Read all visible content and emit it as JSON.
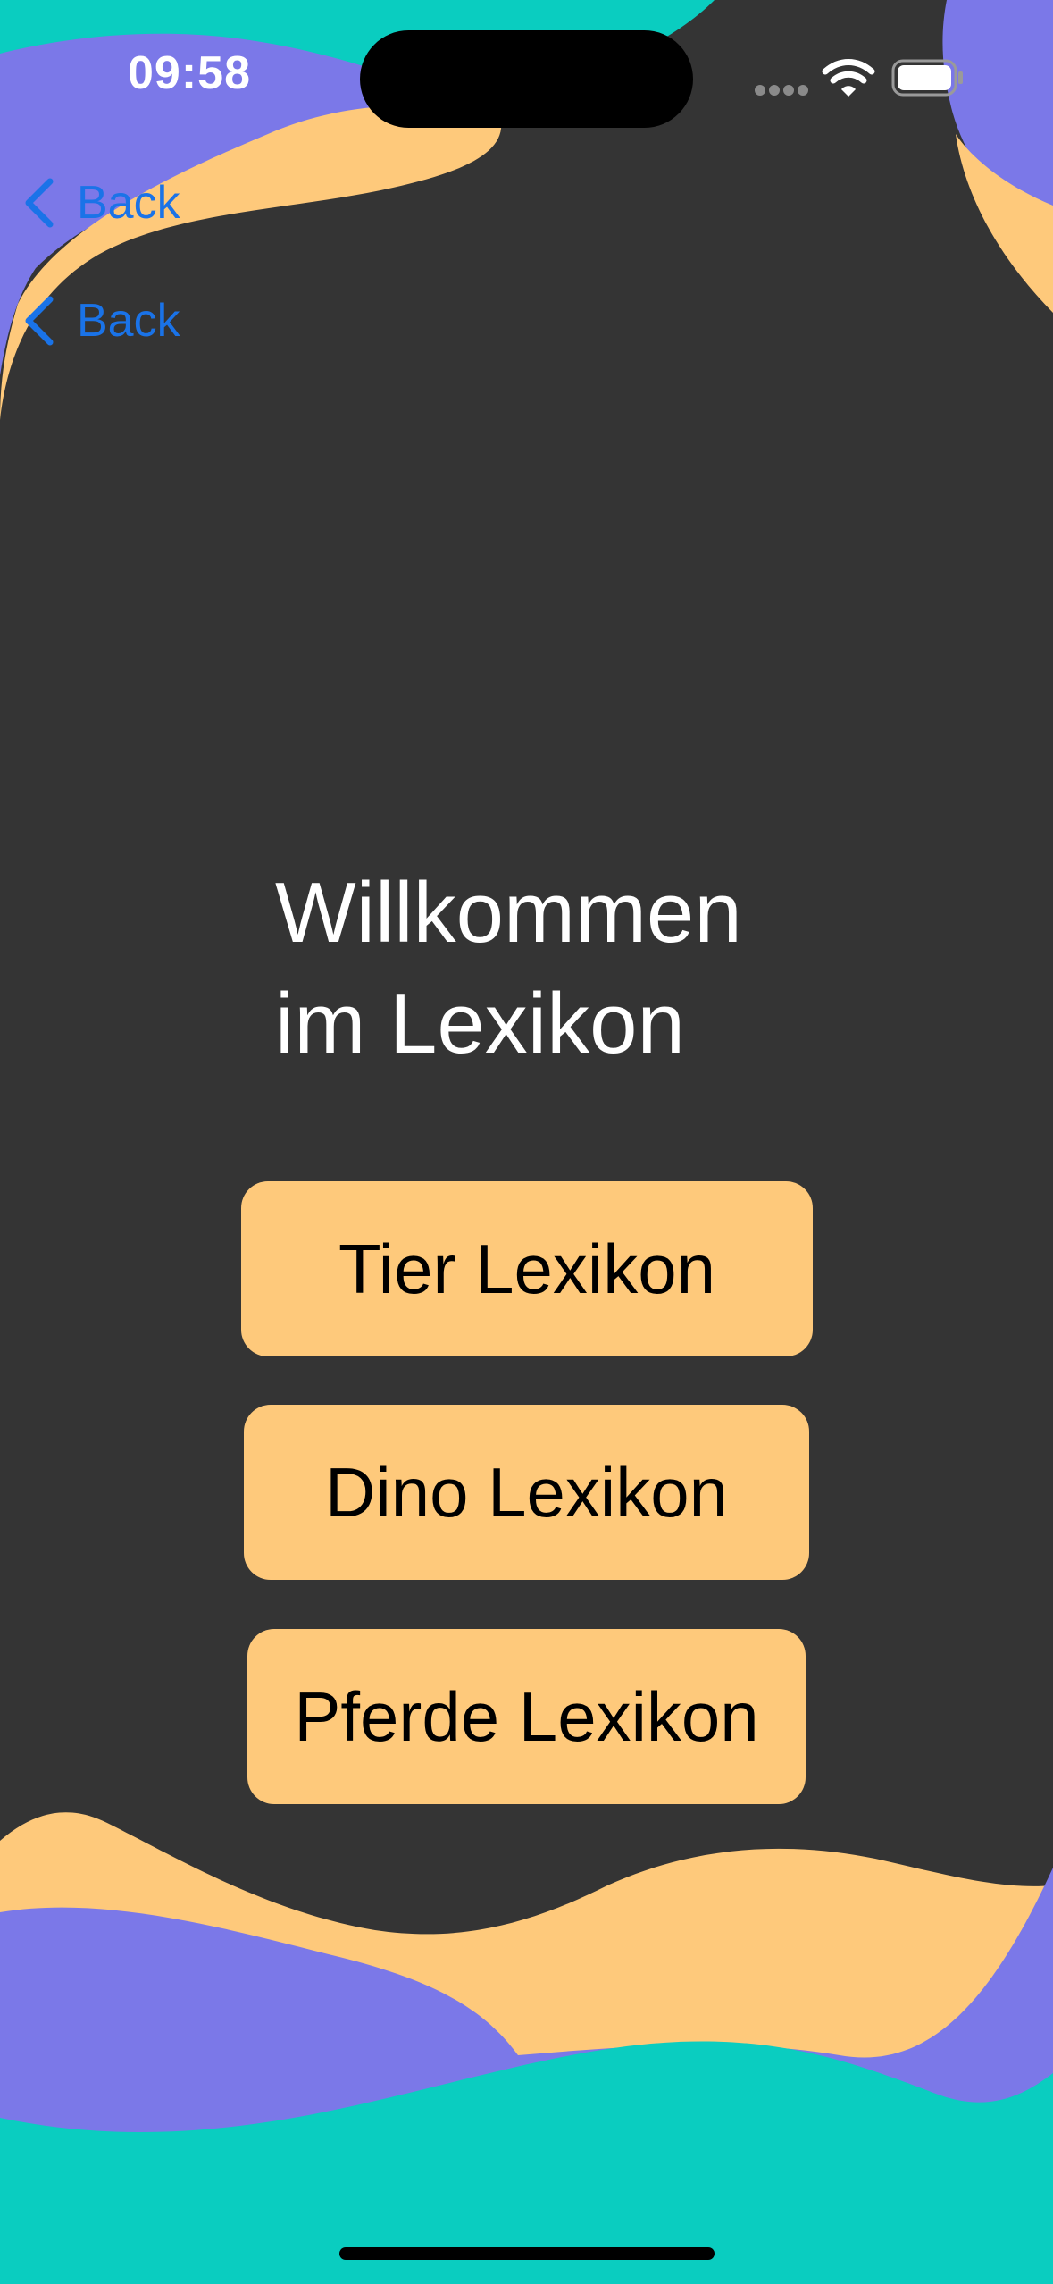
{
  "status_bar": {
    "time": "09:58"
  },
  "navigation": {
    "back_buttons": [
      {
        "label": "Back"
      },
      {
        "label": "Back"
      }
    ]
  },
  "main": {
    "title_line1": "Willkommen",
    "title_line2": "im Lexikon",
    "buttons": [
      {
        "label": "Tier Lexikon"
      },
      {
        "label": "Dino Lexikon"
      },
      {
        "label": "Pferde Lexikon"
      }
    ]
  },
  "colors": {
    "background": "#343434",
    "accent_orange": "#fec97b",
    "accent_purple": "#7b78e8",
    "accent_teal": "#0acdc0",
    "link_blue": "#1a73e8"
  },
  "icons": {
    "back": "chevron-left-icon",
    "wifi": "wifi-icon",
    "battery": "battery-icon",
    "cellular": "cellular-signal-icon"
  }
}
